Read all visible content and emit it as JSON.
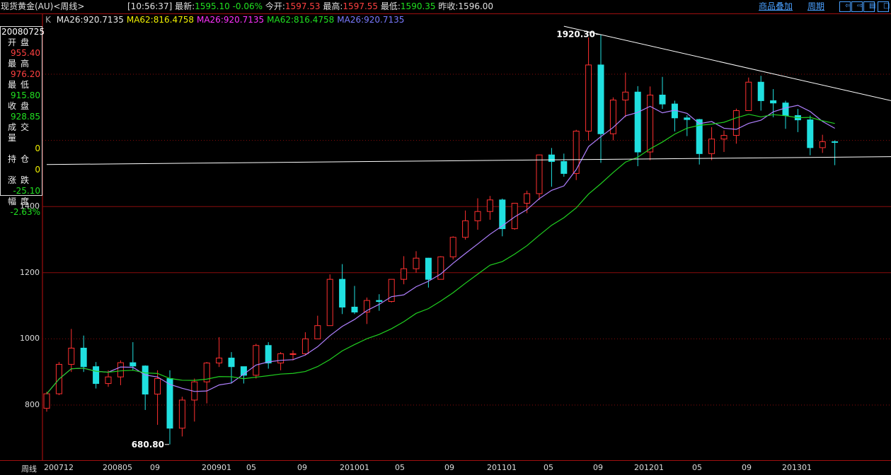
{
  "header": {
    "title": "现货黄金(AU)<周线>",
    "time": "[10:56:37]",
    "latest_label": "最新:",
    "latest": "1595.10",
    "change_pct": "-0.06%",
    "open_label": "今开:",
    "open": "1597.53",
    "high_label": "最高:",
    "high": "1597.55",
    "low_label": "最低:",
    "low": "1590.35",
    "prev_label": "昨收:",
    "prev": "1596.00",
    "overlay_link": "商品叠加",
    "period_link": "周期",
    "buttons": [
      "left-arrow",
      "right-arrow",
      "split-panel",
      "maximize"
    ]
  },
  "ma_legend": {
    "k": "K",
    "items": [
      {
        "text": "MA26:920.7135",
        "color": "#e8e8e8"
      },
      {
        "text": "MA62:816.4758",
        "color": "#f0f000"
      },
      {
        "text": "MA26:920.7135",
        "color": "#ff30ff"
      },
      {
        "text": "MA62:816.4758",
        "color": "#20e020"
      },
      {
        "text": "MA26:920.7135",
        "color": "#7a7aff"
      }
    ]
  },
  "info_panel": {
    "date": "20080725",
    "rows": [
      {
        "label": "开盘",
        "value": "955.40",
        "color": "#ff4040"
      },
      {
        "label": "最高",
        "value": "976.20",
        "color": "#ff4040"
      },
      {
        "label": "最低",
        "value": "915.80",
        "color": "#20e020"
      },
      {
        "label": "收盘",
        "value": "928.85",
        "color": "#20e020"
      },
      {
        "label": "成交量",
        "value": "0",
        "color": "#f0f000"
      },
      {
        "label": "持仓",
        "value": "0",
        "color": "#f0f000"
      },
      {
        "label": "涨跌",
        "value": "-25.10",
        "color": "#20e020"
      },
      {
        "label": "幅度",
        "value": "-2.63%",
        "color": "#20e020"
      }
    ]
  },
  "chart_data": {
    "type": "candlestick",
    "period_label": "周线",
    "x_tick_labels": [
      "200712",
      "200805",
      "09",
      "200901",
      "05",
      "09",
      "201001",
      "05",
      "09",
      "201101",
      "05",
      "09",
      "201201",
      "05",
      "09",
      "201301"
    ],
    "y_ticks": [
      800,
      1000,
      1200,
      1400
    ],
    "ylim": [
      660,
      1960
    ],
    "grid": true,
    "colors": {
      "up": "#ff3030",
      "down": "#20e0e0",
      "ma26": "#b080ff",
      "ma62": "#20d020",
      "trendline": "#ffffff"
    },
    "annotations": [
      {
        "text": "1920.30",
        "value": 1920.3,
        "month": "2011-09"
      },
      {
        "text": "680.80",
        "value": 680.8,
        "month": "2008-10"
      }
    ],
    "trendlines": [
      {
        "from": [
          "2011-06",
          1945
        ],
        "to": [
          "2013-12",
          1691
        ]
      },
      {
        "from": [
          "2007-12",
          1527
        ],
        "to": [
          "2013-12",
          1552
        ]
      }
    ],
    "months": [
      "2007-12",
      "2008-01",
      "2008-02",
      "2008-03",
      "2008-04",
      "2008-05",
      "2008-06",
      "2008-07",
      "2008-08",
      "2008-09",
      "2008-10",
      "2008-11",
      "2008-12",
      "2009-01",
      "2009-02",
      "2009-03",
      "2009-04",
      "2009-05",
      "2009-06",
      "2009-07",
      "2009-08",
      "2009-09",
      "2009-10",
      "2009-11",
      "2009-12",
      "2010-01",
      "2010-02",
      "2010-03",
      "2010-04",
      "2010-05",
      "2010-06",
      "2010-07",
      "2010-08",
      "2010-09",
      "2010-10",
      "2010-11",
      "2010-12",
      "2011-01",
      "2011-02",
      "2011-03",
      "2011-04",
      "2011-05",
      "2011-06",
      "2011-07",
      "2011-08",
      "2011-09",
      "2011-10",
      "2011-11",
      "2011-12",
      "2012-01",
      "2012-02",
      "2012-03",
      "2012-04",
      "2012-05",
      "2012-06",
      "2012-07",
      "2012-08",
      "2012-09",
      "2012-10",
      "2012-11",
      "2012-12",
      "2013-01",
      "2013-02",
      "2013-03",
      "2013-04"
    ],
    "ohlc": [
      [
        790,
        840,
        780,
        834
      ],
      [
        834,
        930,
        830,
        923
      ],
      [
        923,
        1030,
        900,
        972
      ],
      [
        972,
        1010,
        900,
        916
      ],
      [
        916,
        930,
        850,
        865
      ],
      [
        865,
        905,
        855,
        885
      ],
      [
        885,
        935,
        860,
        928
      ],
      [
        928,
        990,
        905,
        918
      ],
      [
        918,
        920,
        785,
        833
      ],
      [
        833,
        905,
        740,
        880
      ],
      [
        880,
        905,
        681,
        730
      ],
      [
        730,
        825,
        705,
        815
      ],
      [
        815,
        880,
        750,
        870
      ],
      [
        870,
        930,
        805,
        927
      ],
      [
        927,
        1005,
        915,
        942
      ],
      [
        942,
        960,
        865,
        916
      ],
      [
        916,
        915,
        865,
        890
      ],
      [
        890,
        985,
        880,
        980
      ],
      [
        980,
        990,
        910,
        927
      ],
      [
        927,
        960,
        905,
        955
      ],
      [
        955,
        965,
        935,
        955
      ],
      [
        955,
        1020,
        950,
        1000
      ],
      [
        1000,
        1070,
        1000,
        1040
      ],
      [
        1040,
        1195,
        1040,
        1180
      ],
      [
        1180,
        1226,
        1075,
        1096
      ],
      [
        1096,
        1160,
        1075,
        1081
      ],
      [
        1081,
        1125,
        1045,
        1116
      ],
      [
        1116,
        1135,
        1085,
        1113
      ],
      [
        1113,
        1180,
        1110,
        1180
      ],
      [
        1180,
        1250,
        1165,
        1212
      ],
      [
        1212,
        1265,
        1200,
        1244
      ],
      [
        1244,
        1245,
        1155,
        1180
      ],
      [
        1180,
        1250,
        1180,
        1248
      ],
      [
        1248,
        1310,
        1240,
        1307
      ],
      [
        1307,
        1388,
        1300,
        1357
      ],
      [
        1357,
        1425,
        1330,
        1385
      ],
      [
        1385,
        1432,
        1360,
        1420
      ],
      [
        1420,
        1424,
        1310,
        1333
      ],
      [
        1333,
        1410,
        1330,
        1410
      ],
      [
        1410,
        1448,
        1380,
        1439
      ],
      [
        1439,
        1557,
        1420,
        1556
      ],
      [
        1556,
        1577,
        1460,
        1536
      ],
      [
        1536,
        1560,
        1490,
        1500
      ],
      [
        1500,
        1632,
        1480,
        1628
      ],
      [
        1628,
        1911,
        1600,
        1828
      ],
      [
        1828,
        1920,
        1532,
        1620
      ],
      [
        1620,
        1730,
        1600,
        1722
      ],
      [
        1722,
        1805,
        1670,
        1746
      ],
      [
        1746,
        1764,
        1522,
        1565
      ],
      [
        1565,
        1763,
        1540,
        1737
      ],
      [
        1737,
        1792,
        1695,
        1710
      ],
      [
        1710,
        1720,
        1627,
        1668
      ],
      [
        1668,
        1676,
        1613,
        1663
      ],
      [
        1663,
        1665,
        1527,
        1560
      ],
      [
        1560,
        1640,
        1540,
        1604
      ],
      [
        1604,
        1630,
        1565,
        1615
      ],
      [
        1615,
        1696,
        1590,
        1690
      ],
      [
        1690,
        1790,
        1690,
        1776
      ],
      [
        1776,
        1795,
        1690,
        1720
      ],
      [
        1720,
        1755,
        1670,
        1713
      ],
      [
        1713,
        1720,
        1635,
        1675
      ],
      [
        1675,
        1695,
        1625,
        1662
      ],
      [
        1662,
        1675,
        1555,
        1578
      ],
      [
        1578,
        1617,
        1562,
        1596
      ],
      [
        1596,
        1600,
        1525,
        1595
      ]
    ]
  }
}
